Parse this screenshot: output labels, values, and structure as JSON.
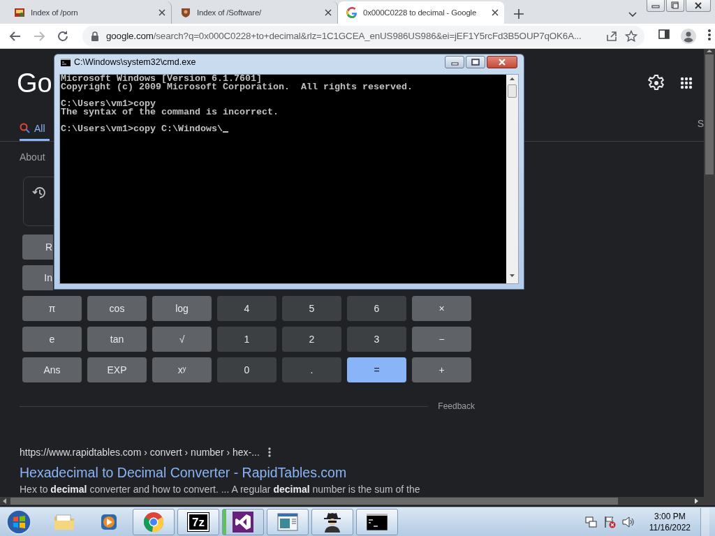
{
  "browser": {
    "tabs": [
      {
        "title": "Index of /porn",
        "selected": false
      },
      {
        "title": "Index of /Software/",
        "selected": false
      },
      {
        "title": "0x000C0228 to decimal - Google",
        "selected": true
      }
    ],
    "back": {
      "disabled": false
    },
    "forward": {
      "disabled": true
    },
    "url_host": "google.com",
    "url_path": "/search?q=0x000C0228+to+decimal&rlz=1C1GCEA_enUS986US986&ei=jEF1Y5rcFd3B5OUP7qOK6A..."
  },
  "google": {
    "logo": "Go",
    "tabs": [
      {
        "label": "All",
        "selected": true
      },
      {
        "label": "S",
        "selected": false
      }
    ],
    "result_stats": "About",
    "calculator": {
      "partial_keys": [
        "R",
        "In"
      ],
      "keys": [
        [
          {
            "label": "π",
            "kind": "func"
          },
          {
            "label": "cos",
            "kind": "func"
          },
          {
            "label": "log",
            "kind": "func"
          },
          {
            "label": "4",
            "kind": "num"
          },
          {
            "label": "5",
            "kind": "num"
          },
          {
            "label": "6",
            "kind": "num"
          },
          {
            "label": "×",
            "kind": "op"
          }
        ],
        [
          {
            "label": "e",
            "kind": "func"
          },
          {
            "label": "tan",
            "kind": "func"
          },
          {
            "label": "√",
            "kind": "func"
          },
          {
            "label": "1",
            "kind": "num"
          },
          {
            "label": "2",
            "kind": "num"
          },
          {
            "label": "3",
            "kind": "num"
          },
          {
            "label": "−",
            "kind": "op"
          }
        ],
        [
          {
            "label": "Ans",
            "kind": "func"
          },
          {
            "label": "EXP",
            "kind": "func"
          },
          {
            "label": "xʸ",
            "kind": "func"
          },
          {
            "label": "0",
            "kind": "num"
          },
          {
            "label": ".",
            "kind": "num"
          },
          {
            "label": "=",
            "kind": "equals"
          },
          {
            "label": "+",
            "kind": "op"
          }
        ]
      ]
    },
    "feedback": "Feedback",
    "result": {
      "url": "https://www.rapidtables.com",
      "breadcrumb": " › convert › number › hex-...",
      "title": "Hexadecimal to Decimal Converter - RapidTables.com",
      "snippet": "Hex to **decimal** converter and how to convert. ... A regular **decimal** number is the sum of the"
    }
  },
  "cmd": {
    "title": "C:\\Windows\\system32\\cmd.exe",
    "blocks": [
      [
        "Microsoft Windows [Version 6.1.7601]",
        "Copyright (c) 2009 Microsoft Corporation.  All rights reserved."
      ],
      [
        "C:\\Users\\vm1>copy",
        "The syntax of the command is incorrect."
      ],
      [
        "C:\\Users\\vm1>copy C:\\Windows\\"
      ]
    ],
    "cursor_visible": true
  },
  "taskbar": {
    "seven_zip_label": "7z",
    "time": "3:00 PM",
    "date": "11/16/2022"
  }
}
